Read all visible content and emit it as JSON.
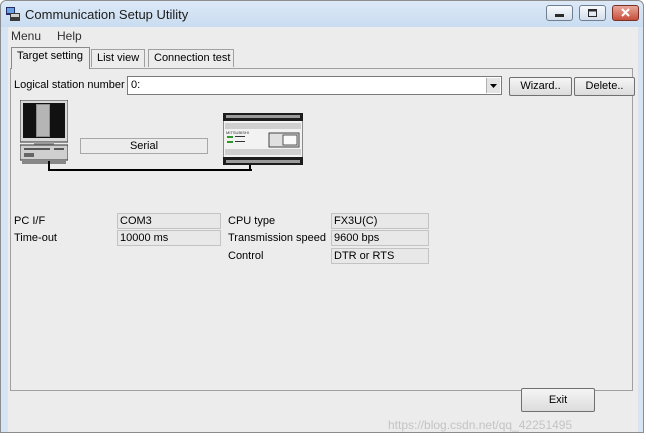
{
  "window": {
    "title": "Communication Setup Utility"
  },
  "menu": {
    "items": [
      "Menu",
      "Help"
    ]
  },
  "tabs": [
    {
      "label": "Target setting",
      "active": true
    },
    {
      "label": "List view",
      "active": false
    },
    {
      "label": "Connection test",
      "active": false
    }
  ],
  "target": {
    "station_label": "Logical station number",
    "station_value": "0:",
    "wizard_label": "Wizard..",
    "delete_label": "Delete..",
    "connection_label": "Serial",
    "plc_badge": "MITSUBISHI"
  },
  "settings": {
    "pc_if_label": "PC I/F",
    "pc_if_value": "COM3",
    "timeout_label": "Time-out",
    "timeout_value": "10000 ms",
    "cpu_type_label": "CPU type",
    "cpu_type_value": "FX3U(C)",
    "transmission_speed_label": "Transmission speed",
    "transmission_speed_value": "9600 bps",
    "control_label": "Control",
    "control_value": "DTR or RTS"
  },
  "footer": {
    "exit_label": "Exit",
    "watermark": "https://blog.csdn.net/qq_42251495"
  },
  "colors": {
    "window_frame": "#d6e4f3",
    "client_bg": "#ececec",
    "close_button": "#c74e3b"
  },
  "icons": {
    "app": "app-icon",
    "minimize": "minimize-icon",
    "maximize": "maximize-icon",
    "close": "close-icon",
    "dropdown": "chevron-down-icon",
    "computer": "computer-icon",
    "plc": "plc-icon"
  }
}
